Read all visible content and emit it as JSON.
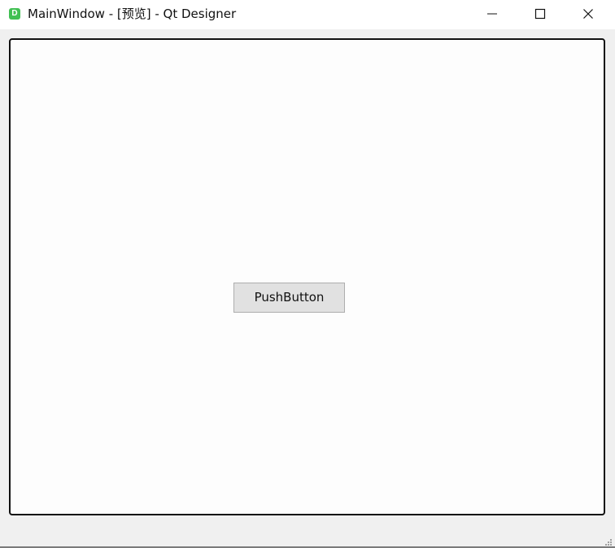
{
  "window": {
    "title": "MainWindow - [预览] - Qt Designer",
    "app_icon": {
      "name": "qt-designer-icon",
      "label": "D",
      "color": "#41c053"
    },
    "controls": {
      "minimize_icon": "minimize-icon",
      "maximize_icon": "maximize-icon",
      "close_icon": "close-icon"
    }
  },
  "main": {
    "push_button_label": "PushButton"
  },
  "colors": {
    "titlebar_background": "#ffffff",
    "client_background": "#f0f0f0",
    "canvas_background": "#fdfdfd",
    "border": "#111111",
    "button_background": "#e1e1e1",
    "button_border": "#adadad"
  }
}
